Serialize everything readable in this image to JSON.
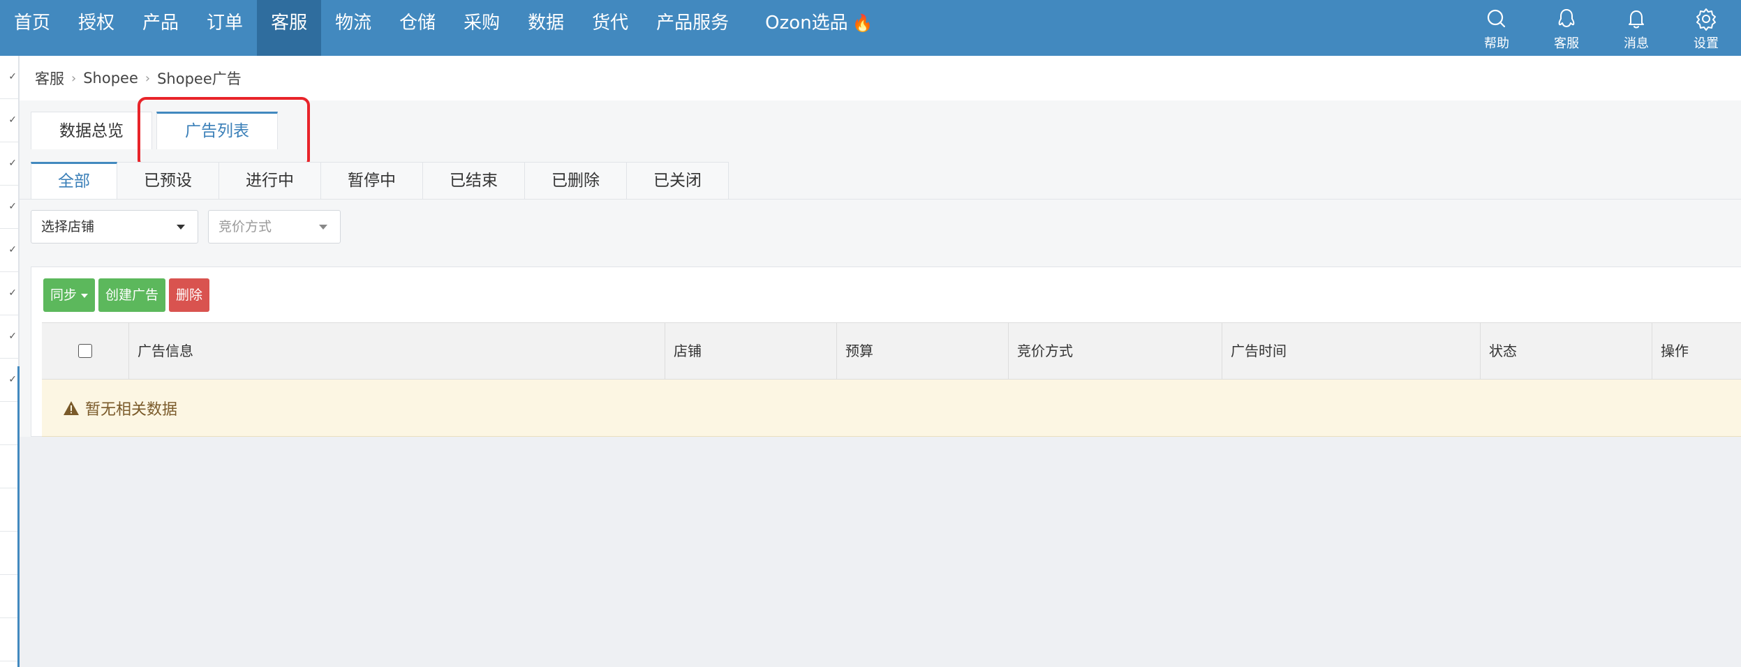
{
  "nav": {
    "items": [
      {
        "label": "首页",
        "active": false
      },
      {
        "label": "授权",
        "active": false
      },
      {
        "label": "产品",
        "active": false
      },
      {
        "label": "订单",
        "active": false
      },
      {
        "label": "客服",
        "active": true
      },
      {
        "label": "物流",
        "active": false
      },
      {
        "label": "仓储",
        "active": false
      },
      {
        "label": "采购",
        "active": false
      },
      {
        "label": "数据",
        "active": false
      },
      {
        "label": "货代",
        "active": false
      },
      {
        "label": "产品服务",
        "active": false
      }
    ],
    "ozon_label": "Ozon选品",
    "ozon_icon": "flame-icon",
    "tools": [
      {
        "label": "帮助",
        "icon": "search-icon"
      },
      {
        "label": "客服",
        "icon": "qq-icon"
      },
      {
        "label": "消息",
        "icon": "bell-icon"
      },
      {
        "label": "设置",
        "icon": "gear-icon"
      }
    ],
    "bg_color": "#4289bf",
    "active_color": "#2f6d9e"
  },
  "breadcrumb": [
    "客服",
    "Shopee",
    "Shopee广告"
  ],
  "main_tabs": [
    {
      "label": "数据总览",
      "active": false
    },
    {
      "label": "广告列表",
      "active": true
    }
  ],
  "status_tabs": [
    {
      "label": "全部",
      "active": true
    },
    {
      "label": "已预设",
      "active": false
    },
    {
      "label": "进行中",
      "active": false
    },
    {
      "label": "暂停中",
      "active": false
    },
    {
      "label": "已结束",
      "active": false
    },
    {
      "label": "已删除",
      "active": false
    },
    {
      "label": "已关闭",
      "active": false
    }
  ],
  "filters": {
    "store_select": "选择店铺",
    "bid_select_placeholder": "竞价方式"
  },
  "toolbar": {
    "sync_label": "同步",
    "create_label": "创建广告",
    "delete_label": "删除"
  },
  "table": {
    "columns": [
      "广告信息",
      "店铺",
      "预算",
      "竞价方式",
      "广告时间",
      "状态",
      "操作"
    ],
    "empty_text": "暂无相关数据"
  },
  "colors": {
    "highlight": "#e8242a",
    "green_button": "#5cb85c",
    "red_button": "#d9534f",
    "empty_row_bg": "#fcf6e3"
  }
}
